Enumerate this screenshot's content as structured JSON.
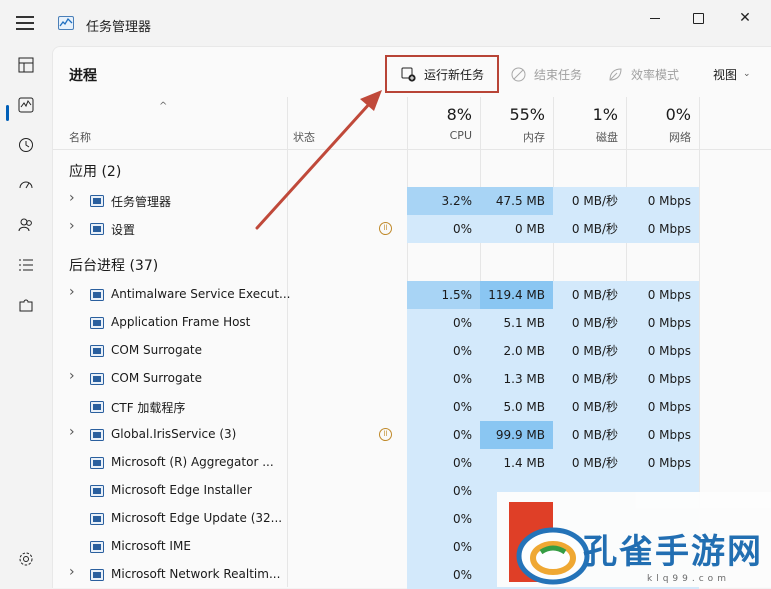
{
  "window": {
    "title": "任务管理器"
  },
  "toolbar": {
    "page_title": "进程",
    "run_task": "运行新任务",
    "end_task": "结束任务",
    "efficiency": "效率模式",
    "view": "视图"
  },
  "columns": {
    "name": "名称",
    "status": "状态",
    "cpu": {
      "pct": "8%",
      "label": "CPU"
    },
    "memory": {
      "pct": "55%",
      "label": "内存"
    },
    "disk": {
      "pct": "1%",
      "label": "磁盘"
    },
    "network": {
      "pct": "0%",
      "label": "网络"
    }
  },
  "groups": {
    "apps": "应用 (2)",
    "background": "后台进程 (37)"
  },
  "rows": [
    {
      "name": "任务管理器",
      "expand": true,
      "status": false,
      "cpu": "3.2%",
      "mem": "47.5 MB",
      "disk": "0 MB/秒",
      "net": "0 Mbps"
    },
    {
      "name": "设置",
      "expand": true,
      "status": true,
      "cpu": "0%",
      "mem": "0 MB",
      "disk": "0 MB/秒",
      "net": "0 Mbps"
    },
    {
      "name": "Antimalware Service Execut...",
      "expand": true,
      "status": false,
      "cpu": "1.5%",
      "mem": "119.4 MB",
      "disk": "0 MB/秒",
      "net": "0 Mbps"
    },
    {
      "name": "Application Frame Host",
      "expand": false,
      "status": false,
      "cpu": "0%",
      "mem": "5.1 MB",
      "disk": "0 MB/秒",
      "net": "0 Mbps"
    },
    {
      "name": "COM Surrogate",
      "expand": false,
      "status": false,
      "cpu": "0%",
      "mem": "2.0 MB",
      "disk": "0 MB/秒",
      "net": "0 Mbps"
    },
    {
      "name": "COM Surrogate",
      "expand": true,
      "status": false,
      "cpu": "0%",
      "mem": "1.3 MB",
      "disk": "0 MB/秒",
      "net": "0 Mbps"
    },
    {
      "name": "CTF 加载程序",
      "expand": false,
      "status": false,
      "cpu": "0%",
      "mem": "5.0 MB",
      "disk": "0 MB/秒",
      "net": "0 Mbps"
    },
    {
      "name": "Global.IrisService (3)",
      "expand": true,
      "status": true,
      "cpu": "0%",
      "mem": "99.9 MB",
      "disk": "0 MB/秒",
      "net": "0 Mbps"
    },
    {
      "name": "Microsoft (R) Aggregator ...",
      "expand": false,
      "status": false,
      "cpu": "0%",
      "mem": "1.4 MB",
      "disk": "0 MB/秒",
      "net": "0 Mbps"
    },
    {
      "name": "Microsoft Edge Installer",
      "expand": false,
      "status": false,
      "cpu": "0%",
      "mem": "",
      "disk": "",
      "net": ""
    },
    {
      "name": "Microsoft Edge Update (32...",
      "expand": false,
      "status": false,
      "cpu": "0%",
      "mem": "",
      "disk": "",
      "net": ""
    },
    {
      "name": "Microsoft IME",
      "expand": false,
      "status": false,
      "cpu": "0%",
      "mem": "",
      "disk": "",
      "net": ""
    },
    {
      "name": "Microsoft Network Realtim...",
      "expand": true,
      "status": false,
      "cpu": "0%",
      "mem": "",
      "disk": "",
      "net": ""
    }
  ],
  "colors": {
    "accent": "#005fb8",
    "heat_light": "#d3e9fb",
    "heat_mid": "#a8d4f5",
    "heat_strong": "#8ac6f2",
    "highlight_border": "#b84436"
  },
  "watermark": {
    "text": "孔雀手游网",
    "url": "klq99.com"
  }
}
